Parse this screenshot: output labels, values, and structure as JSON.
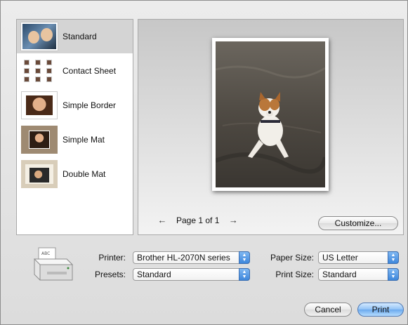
{
  "layouts": [
    {
      "label": "Standard",
      "thumb": "standard-thumbnail",
      "selected": true
    },
    {
      "label": "Contact Sheet",
      "thumb": "contact-sheet-thumbnail",
      "selected": false
    },
    {
      "label": "Simple Border",
      "thumb": "simple-border-thumbnail",
      "selected": false
    },
    {
      "label": "Simple Mat",
      "thumb": "simple-mat-thumbnail",
      "selected": false
    },
    {
      "label": "Double Mat",
      "thumb": "double-mat-thumbnail",
      "selected": false
    }
  ],
  "preview": {
    "page_label": "Page 1 of 1",
    "prev_icon": "arrow-left-icon",
    "next_icon": "arrow-right-icon",
    "customize_label": "Customize..."
  },
  "printer_icon_label": "ABC",
  "form": {
    "printer_label": "Printer:",
    "printer_value": "Brother HL-2070N series",
    "presets_label": "Presets:",
    "presets_value": "Standard",
    "paper_size_label": "Paper Size:",
    "paper_size_value": "US Letter",
    "print_size_label": "Print Size:",
    "print_size_value": "Standard"
  },
  "buttons": {
    "cancel_label": "Cancel",
    "print_label": "Print"
  },
  "colors": {
    "accent": "#6aa9ee",
    "selection": "#d4d4d4"
  }
}
